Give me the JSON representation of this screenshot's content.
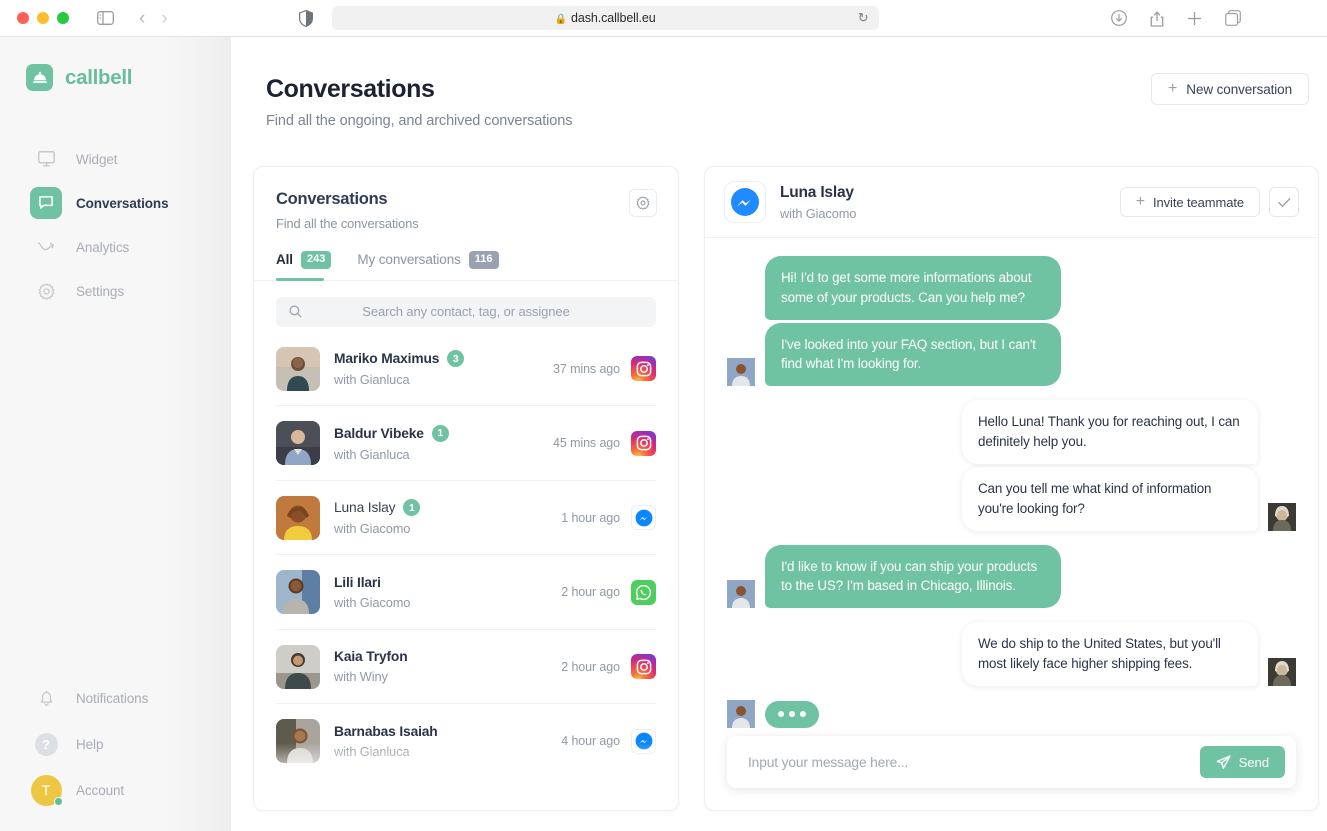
{
  "browser": {
    "url": "dash.callbell.eu",
    "lock_icon": "lock-icon",
    "reload_icon": "reload-icon",
    "shield_icon": "privacy-shield-icon",
    "back_icon": "back-chevron-icon",
    "forward_icon": "forward-chevron-icon",
    "sidebar_icon": "sidebar-toggle-icon",
    "download_icon": "download-icon",
    "share_icon": "share-icon",
    "newtab_icon": "plus-icon",
    "tabs_icon": "tab-overview-icon"
  },
  "brand": {
    "name": "callbell",
    "logo_icon": "service-bell-icon",
    "accent": "#6fc3a3"
  },
  "sidebar": {
    "items": [
      {
        "label": "Widget",
        "icon": "monitor-icon",
        "active": false
      },
      {
        "label": "Conversations",
        "icon": "chat-bubble-icon",
        "active": true
      },
      {
        "label": "Analytics",
        "icon": "trend-arrow-icon",
        "active": false
      },
      {
        "label": "Settings",
        "icon": "gear-icon",
        "active": false
      }
    ],
    "bottom_items": [
      {
        "label": "Notifications",
        "icon": "bell-icon"
      },
      {
        "label": "Help",
        "icon": "question-mark-icon"
      },
      {
        "label": "Account",
        "icon": "avatar",
        "avatar_initial": "T",
        "avatar_color": "#edc644",
        "status_color": "#5ac08f"
      }
    ]
  },
  "header": {
    "title": "Conversations",
    "subtitle": "Find all the ongoing, and archived conversations",
    "new_conversation_label": "New conversation",
    "new_conversation_icon": "plus-icon"
  },
  "conversations_panel": {
    "title": "Conversations",
    "subtitle": "Find all the conversations",
    "settings_icon": "gear-icon",
    "tabs": [
      {
        "label": "All",
        "count": "243",
        "active": true
      },
      {
        "label": "My conversations",
        "count": "116",
        "active": false
      }
    ],
    "search": {
      "placeholder": "Search any contact, tag, or assignee",
      "value": "",
      "icon": "search-icon"
    },
    "rows": [
      {
        "name": "Mariko Maximus",
        "badge": "3",
        "with": "with Gianluca",
        "time": "37 mins ago",
        "channel": "instagram",
        "selected": false
      },
      {
        "name": "Baldur Vibeke",
        "badge": "1",
        "with": "with Gianluca",
        "time": "45 mins ago",
        "channel": "instagram",
        "selected": false
      },
      {
        "name": "Luna Islay",
        "badge": "1",
        "with": "with Giacomo",
        "time": "1 hour ago",
        "channel": "messenger",
        "selected": true
      },
      {
        "name": "Lili Ilari",
        "badge": "",
        "with": "with Giacomo",
        "time": "2 hour ago",
        "channel": "whatsapp",
        "selected": false
      },
      {
        "name": "Kaia Tryfon",
        "badge": "",
        "with": "with Winy",
        "time": "2 hour ago",
        "channel": "instagram",
        "selected": false
      },
      {
        "name": "Barnabas Isaiah",
        "badge": "",
        "with": "with Gianluca",
        "time": "4 hour ago",
        "channel": "messenger",
        "selected": false
      }
    ]
  },
  "chat_panel": {
    "contact_name": "Luna Islay",
    "contact_with": "with Giacomo",
    "channel": "messenger",
    "channel_icon": "messenger-icon",
    "invite_label": "Invite teammate",
    "invite_icon": "plus-icon",
    "resolve_icon": "check-icon",
    "messages": [
      {
        "side": "in",
        "texts": [
          "Hi! I'd to get some more informations about some of your products. Can you help me?",
          "I've looked into your FAQ section, but I can't find what I'm looking for."
        ]
      },
      {
        "side": "out",
        "texts": [
          "Hello Luna! Thank you for reaching out, I can definitely help you.",
          "Can you tell me what kind of information you're looking for?"
        ]
      },
      {
        "side": "in",
        "texts": [
          "I'd like to know if you can ship your products to the US? I'm based in Chicago, Illinois."
        ]
      },
      {
        "side": "out",
        "texts": [
          "We do ship to the United States, but you'll most likely face higher shipping fees."
        ]
      },
      {
        "side": "in",
        "typing": true,
        "texts": []
      }
    ],
    "composer": {
      "placeholder": "Input your message here...",
      "value": "",
      "send_label": "Send",
      "send_icon": "paper-plane-icon"
    }
  }
}
